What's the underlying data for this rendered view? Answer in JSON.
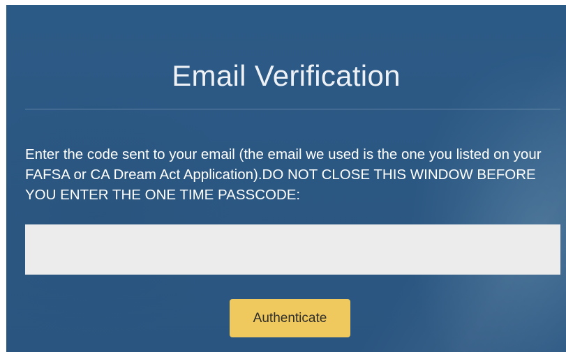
{
  "dialog": {
    "title": "Email Verification",
    "instructions": "Enter the code sent to your email (the email we used is the one you listed on your FAFSA or CA Dream Act Application).DO NOT CLOSE THIS WINDOW BEFORE YOU ENTER THE ONE TIME PASSCODE:",
    "passcode_value": "",
    "passcode_placeholder": "",
    "authenticate_label": "Authenticate"
  },
  "colors": {
    "background": "#2b5883",
    "title_text": "#eef2f6",
    "input_background": "#ececec",
    "button_background": "#efc95e",
    "button_text": "#2d2d2d"
  }
}
